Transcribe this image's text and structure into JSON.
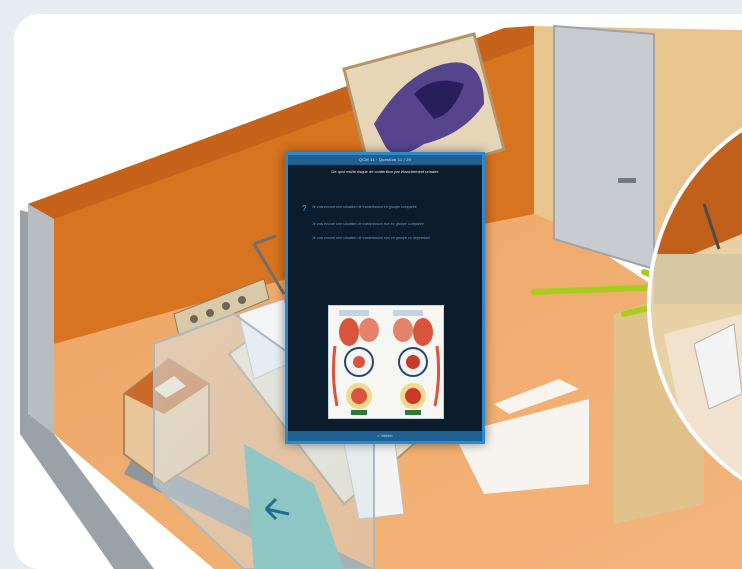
{
  "dialog": {
    "header": "QCM 11 · Question 11 / 20",
    "question": "De quoi est/le risque de contention par étanchement urinaire",
    "answers": [
      {
        "marker": "?",
        "text": "Je vois encore une situation de transmission en groupe comparée"
      },
      {
        "marker": "",
        "text": "Je vois encore une situation de transmission non en groupe comparée"
      },
      {
        "marker": "",
        "text": "Je vois encore une situation de transmission non en groupe en dépendant"
      }
    ],
    "footer": "< Valider"
  },
  "colors": {
    "dialog_border": "#2a8ad0",
    "dialog_bg": "#0b1d2c",
    "wall_orange": "#d8731f",
    "floor": "#eea866",
    "arrow": "#a8cc1c",
    "lens_border": "#ffffff"
  }
}
